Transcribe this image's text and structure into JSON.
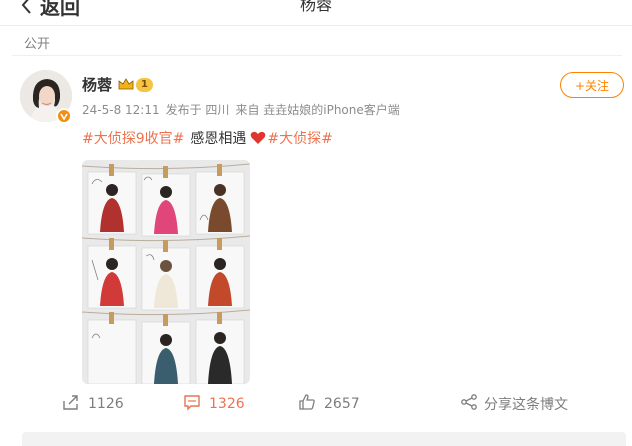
{
  "header": {
    "back_label": "返回",
    "title": "杨蓉"
  },
  "post": {
    "visibility": "公开",
    "user": {
      "name": "杨蓉",
      "level": "1"
    },
    "meta": {
      "date": "24-5-8 12:11",
      "location": "发布于 四川",
      "source": "来自 垚垚姑娘的iPhone客户端"
    },
    "follow_label": "+关注",
    "text": {
      "tag1": "#大侦探9收官#",
      "body": "感恩相遇",
      "tag2": "#大侦探#"
    },
    "actions": {
      "share": "1126",
      "comment": "1326",
      "like": "2657",
      "forward_label": "分享这条博文"
    }
  },
  "colors": {
    "accent": "#ff8200",
    "hashtag": "#eb7350",
    "verified": "#f08f12",
    "heart": "#e0342e"
  }
}
